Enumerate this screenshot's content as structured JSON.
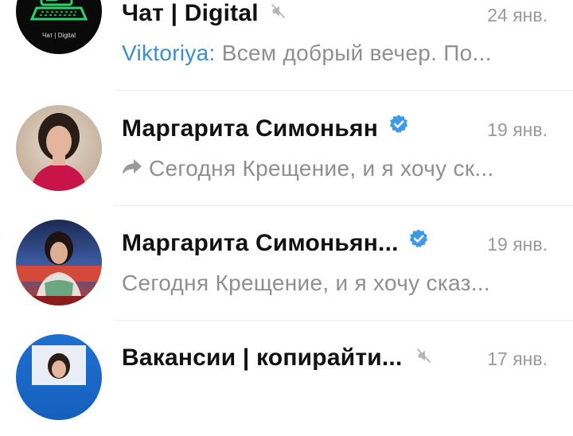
{
  "chats": [
    {
      "title": "Чат | Digital",
      "date": "24 янв.",
      "sender": "Viktoriya:",
      "preview": " Всем добрый вечер. По...",
      "avatar_caption": "Чат | Digital",
      "muted": true,
      "verified": false,
      "forwarded": false
    },
    {
      "title": "Маргарита Симоньян",
      "date": "19 янв.",
      "preview": "Сегодня Крещение, и я хочу ск...",
      "muted": false,
      "verified": true,
      "forwarded": true
    },
    {
      "title": "Маргарита Симоньян...",
      "date": "19 янв.",
      "preview": "Сегодня Крещение, и я хочу сказ...",
      "muted": false,
      "verified": true,
      "forwarded": false
    },
    {
      "title": "Вакансии | копирайти...",
      "date": "17 янв.",
      "muted": true,
      "verified": false,
      "forwarded": false
    }
  ],
  "colors": {
    "sender": "#3d8ec9",
    "verified_badge": "#3d9ae8",
    "muted_icon": "#b5b5b5",
    "date": "#9a9a9a"
  },
  "icons": {
    "mute": "mute-icon",
    "verified": "verified-badge-icon",
    "forward": "forward-icon",
    "laptop": "laptop-icon"
  }
}
